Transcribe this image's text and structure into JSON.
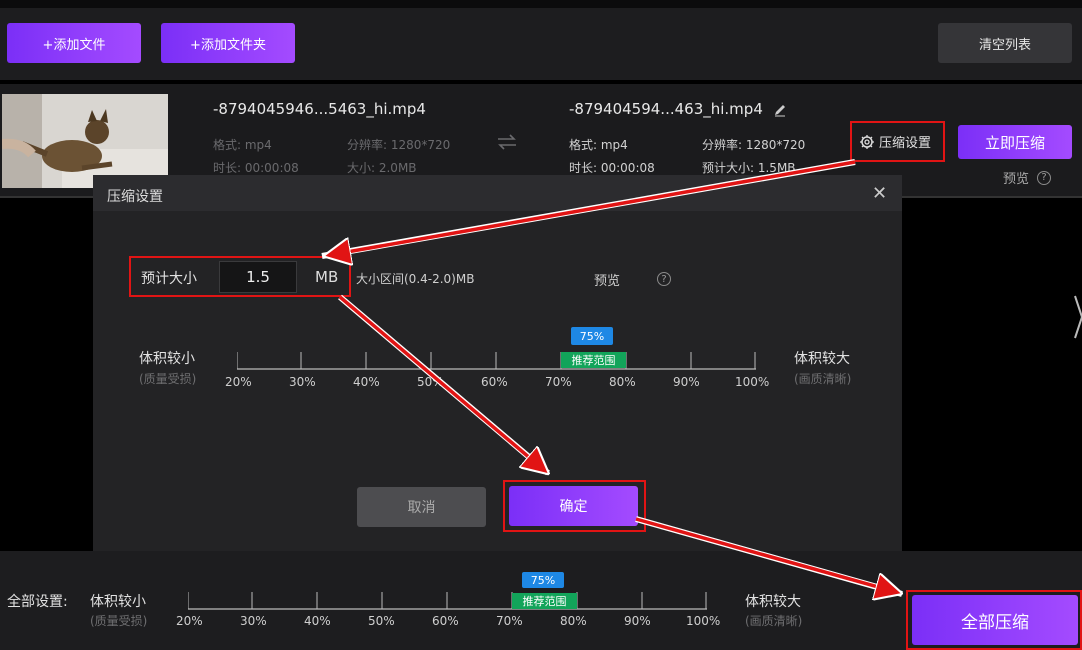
{
  "toolbar": {
    "add_file": "+添加文件",
    "add_folder": "+添加文件夹",
    "clear_list": "清空列表"
  },
  "file": {
    "source": {
      "name": "-8794045946...5463_hi.mp4",
      "format": "格式: mp4",
      "resolution": "分辨率: 1280*720",
      "duration": "时长: 00:00:08",
      "size": "大小: 2.0MB"
    },
    "target": {
      "name": "-879404594...463_hi.mp4",
      "format": "格式: mp4",
      "resolution": "分辨率: 1280*720",
      "duration": "时长: 00:00:08",
      "est_size": "预计大小: 1.5MB"
    },
    "compress_settings": "压缩设置",
    "compress_now": "立即压缩",
    "preview": "预览"
  },
  "dialog": {
    "title": "压缩设置",
    "est_size_label": "预计大小",
    "size_value": "1.5",
    "unit": "MB",
    "range": "大小区间(0.4-2.0)MB",
    "preview": "预览",
    "smaller_label": "体积较小",
    "smaller_sub": "(质量受损)",
    "larger_label": "体积较大",
    "larger_sub": "(画质清晰)",
    "current_percent": "75%",
    "recommend": "推荐范围",
    "ticks": [
      "20%",
      "30%",
      "40%",
      "50%",
      "60%",
      "70%",
      "80%",
      "90%",
      "100%"
    ],
    "cancel": "取消",
    "confirm": "确定"
  },
  "bottom": {
    "all_settings": "全部设置:",
    "smaller_label": "体积较小",
    "smaller_sub": "(质量受损)",
    "larger_label": "体积较大",
    "larger_sub": "(画质清晰)",
    "current_percent": "75%",
    "recommend": "推荐范围",
    "ticks": [
      "20%",
      "30%",
      "40%",
      "50%",
      "60%",
      "70%",
      "80%",
      "90%",
      "100%"
    ],
    "compress_all": "全部压缩"
  },
  "colors": {
    "accent_purple": "#8a3bff",
    "highlight_red": "#e11414",
    "badge_blue": "#1e88e5",
    "badge_green": "#12a45a"
  }
}
